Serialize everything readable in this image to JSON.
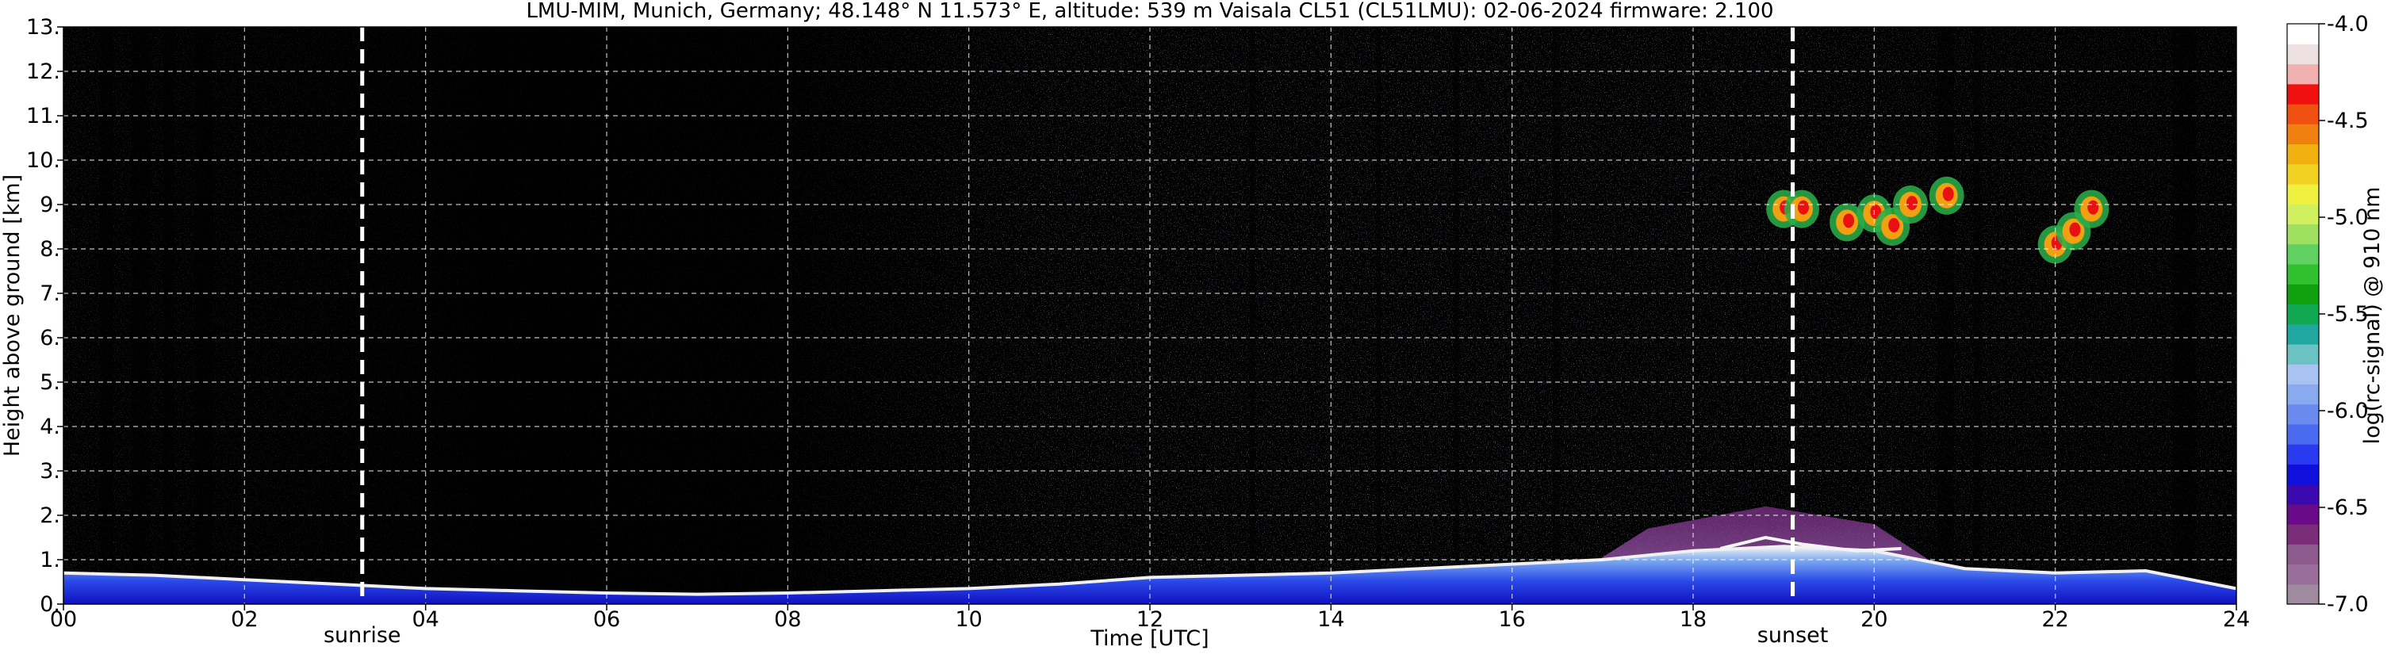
{
  "chart_data": {
    "type": "heatmap",
    "title": "LMU-MIM, Munich, Germany; 48.148° N 11.573° E, altitude: 539 m    Vaisala CL51 (CL51LMU): 02-06-2024    firmware: 2.100",
    "xlabel": "Time [UTC]",
    "ylabel": "Height above ground [km]",
    "xlim": [
      0,
      24
    ],
    "ylim": [
      0,
      13
    ],
    "x_ticks": [
      0,
      2,
      4,
      6,
      8,
      10,
      12,
      14,
      16,
      18,
      20,
      22,
      24
    ],
    "x_tick_labels": [
      "00",
      "02",
      "04",
      "06",
      "08",
      "10",
      "12",
      "14",
      "16",
      "18",
      "20",
      "22",
      "24"
    ],
    "y_ticks": [
      0,
      1,
      2,
      3,
      4,
      5,
      6,
      7,
      8,
      9,
      10,
      11,
      12,
      13
    ],
    "y_tick_labels": [
      "0.",
      "1.",
      "2.",
      "3.",
      "4.",
      "5.",
      "6.",
      "7.",
      "8.",
      "9.",
      "10.",
      "11.",
      "12.",
      "13."
    ],
    "grid": true,
    "annotations": [
      {
        "text": "sunrise",
        "x": 3.3
      },
      {
        "text": "sunset",
        "x": 19.1
      }
    ],
    "colorbar": {
      "label": "log(rc-signal) @ 910 nm",
      "range": [
        -7.0,
        -4.0
      ],
      "ticks": [
        -7.0,
        -6.5,
        -6.0,
        -5.5,
        -5.0,
        -4.5,
        -4.0
      ],
      "tick_labels": [
        "-7.0",
        "-6.5",
        "-6.0",
        "-5.5",
        "-5.0",
        "-4.5",
        "-4.0"
      ],
      "colors": [
        "#a08aa0",
        "#9a6e9a",
        "#8c5a8c",
        "#7a2e7a",
        "#6a0a88",
        "#3a0ab0",
        "#1010dd",
        "#2a3af0",
        "#4a6af0",
        "#6a8af0",
        "#8aaaf0",
        "#a8c2f2",
        "#6ac2c2",
        "#20a8a0",
        "#10a850",
        "#10a010",
        "#30c030",
        "#60d060",
        "#a0e060",
        "#d0f060",
        "#f0f040",
        "#f0d020",
        "#f0b010",
        "#f08010",
        "#f05010",
        "#f01010",
        "#f0b0b0",
        "#ece0e0",
        "#ffffff"
      ]
    },
    "series": [
      {
        "values": [
          [
            0.0,
            0.7
          ],
          [
            1.0,
            0.65
          ],
          [
            2.0,
            0.55
          ],
          [
            3.0,
            0.45
          ],
          [
            4.0,
            0.35
          ],
          [
            5.0,
            0.3
          ],
          [
            6.0,
            0.25
          ],
          [
            7.0,
            0.22
          ],
          [
            8.0,
            0.25
          ],
          [
            9.0,
            0.3
          ],
          [
            10.0,
            0.35
          ],
          [
            11.0,
            0.45
          ],
          [
            12.0,
            0.6
          ],
          [
            13.0,
            0.65
          ],
          [
            14.0,
            0.7
          ],
          [
            15.0,
            0.8
          ],
          [
            16.0,
            0.9
          ],
          [
            17.0,
            1.0
          ],
          [
            18.0,
            1.2
          ],
          [
            19.0,
            1.3
          ],
          [
            20.0,
            1.2
          ],
          [
            21.0,
            0.8
          ],
          [
            22.0,
            0.7
          ],
          [
            23.0,
            0.75
          ],
          [
            24.0,
            0.35
          ]
        ]
      },
      {
        "values": [
          [
            18.3,
            1.25
          ],
          [
            18.8,
            1.5
          ],
          [
            19.2,
            1.35
          ],
          [
            19.8,
            1.2
          ],
          [
            20.3,
            1.25
          ]
        ]
      },
      {
        "values": [
          [
            19.0,
            8.9
          ],
          [
            19.2,
            8.9
          ],
          [
            19.7,
            8.6
          ],
          [
            20.0,
            8.8
          ],
          [
            20.2,
            8.5
          ],
          [
            20.4,
            9.0
          ],
          [
            20.8,
            9.2
          ],
          [
            22.0,
            8.1
          ],
          [
            22.2,
            8.4
          ],
          [
            22.4,
            8.9
          ]
        ]
      }
    ]
  }
}
